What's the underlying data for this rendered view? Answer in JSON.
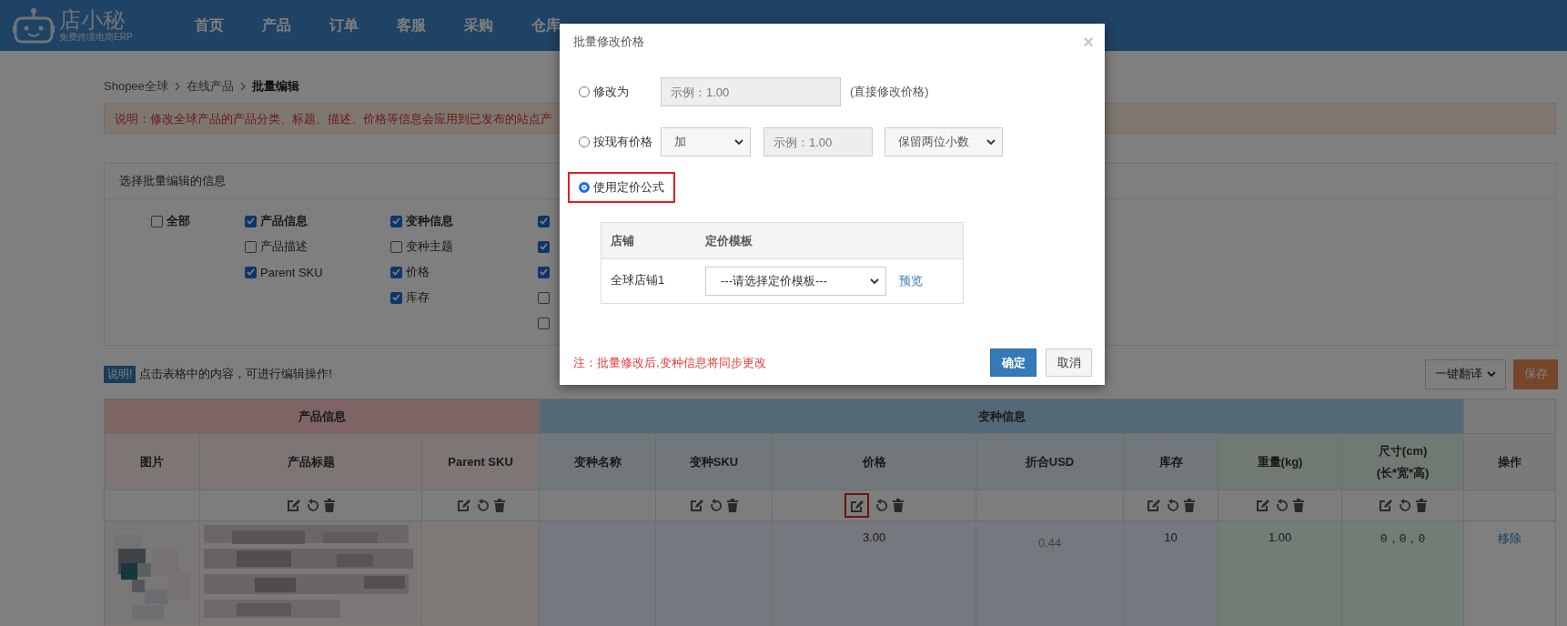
{
  "header": {
    "logo": {
      "name": "店小秘",
      "tagline": "免费跨境电商ERP"
    },
    "nav": [
      {
        "label": "首页"
      },
      {
        "label": "产品"
      },
      {
        "label": "订单"
      },
      {
        "label": "客服"
      },
      {
        "label": "采购"
      },
      {
        "label": "仓库"
      }
    ]
  },
  "breadcrumb": [
    {
      "label": "Shopee全球",
      "current": false
    },
    {
      "label": "在线产品",
      "current": false
    },
    {
      "label": "批量编辑",
      "current": true
    }
  ],
  "notice": "说明：修改全球产品的产品分类、标题、描述、价格等信息会应用到已发布的站点产",
  "edit_panel": {
    "title": "选择批量编辑的信息",
    "columns": [
      [
        {
          "label": "全部",
          "kind": "group",
          "checked": false
        }
      ],
      [
        {
          "label": "产品信息",
          "kind": "group",
          "checked": true
        },
        {
          "label": "产品描述",
          "kind": "field",
          "checked": false
        },
        {
          "label": "Parent SKU",
          "kind": "field",
          "checked": true
        }
      ],
      [
        {
          "label": "变种信息",
          "kind": "group",
          "checked": true
        },
        {
          "label": "变种主题",
          "kind": "field",
          "checked": false
        },
        {
          "label": "价格",
          "kind": "field",
          "checked": true
        },
        {
          "label": "库存",
          "kind": "field",
          "checked": true
        }
      ],
      [
        {
          "checked": true
        },
        {
          "checked": true
        },
        {
          "checked": true
        },
        {
          "checked": false
        },
        {
          "checked": false
        }
      ]
    ]
  },
  "tip": {
    "badge": "说明!",
    "text": "点击表格中的内容，可进行编辑操作!"
  },
  "actions": {
    "translate": "一键翻译",
    "save": "保存"
  },
  "table": {
    "groups": [
      {
        "label": "产品信息",
        "kind": "product",
        "columns": [
          {
            "label": "图片",
            "kind": "product",
            "tools": false
          },
          {
            "label": "产品标题",
            "kind": "product",
            "tools": true
          },
          {
            "label": "Parent SKU",
            "kind": "product",
            "tools": true
          }
        ]
      },
      {
        "label": "变种信息",
        "kind": "variant",
        "columns": [
          {
            "label": "变种名称",
            "kind": "variant",
            "tools": false
          },
          {
            "label": "变种SKU",
            "kind": "variant",
            "tools": true
          },
          {
            "label": "价格",
            "kind": "variant",
            "tools": true,
            "highlighted": true
          },
          {
            "label": "折合USD",
            "kind": "variant",
            "tools": false
          },
          {
            "label": "库存",
            "kind": "variant",
            "tools": true
          },
          {
            "label": "重量(kg)",
            "kind": "physical",
            "tools": true
          },
          {
            "label": "尺寸(cm)",
            "sublabel": "(长*宽*高)",
            "kind": "physical",
            "tools": true
          }
        ]
      },
      {
        "kind": "action",
        "columns": [
          {
            "label": "操作",
            "kind": "action",
            "tools": false
          }
        ]
      }
    ],
    "rows": [
      {
        "cells": [
          {
            "kind": "picture"
          },
          {
            "kind": "picture"
          },
          {
            "kind": "empty"
          },
          {
            "kind": "empty"
          },
          {
            "kind": "empty"
          },
          {
            "kind": "text",
            "text": "3.00"
          },
          {
            "kind": "muted",
            "text": "0.44"
          },
          {
            "kind": "text",
            "text": "10"
          },
          {
            "kind": "text",
            "text": "1.00"
          },
          {
            "kind": "mono",
            "text": "0，0，0"
          },
          {
            "kind": "link",
            "text": "移除"
          }
        ]
      }
    ]
  },
  "dialog": {
    "title": "批量修改价格",
    "close": "×",
    "options": [
      {
        "kind": "value",
        "label": "修改为",
        "selected": false,
        "highlighted": false,
        "placeholder": "示例：1.00",
        "hint": "(直接修改价格)"
      },
      {
        "kind": "adjust",
        "label": "按现有价格",
        "selected": false,
        "highlighted": false,
        "operator": "加",
        "placeholder": "示例：1.00",
        "rounding": "保留两位小数"
      },
      {
        "kind": "formula",
        "label": "使用定价公式",
        "selected": true,
        "highlighted": true
      }
    ],
    "template_table": {
      "columns": [
        "店铺",
        "定价模板"
      ],
      "rows": [
        {
          "store": "全球店铺1",
          "template": "---请选择定价模板---",
          "link": "预览"
        }
      ]
    },
    "note": "注：批量修改后,变种信息将同步更改",
    "buttons": [
      {
        "label": "确定",
        "kind": "primary"
      },
      {
        "label": "取消",
        "kind": "default"
      }
    ]
  }
}
